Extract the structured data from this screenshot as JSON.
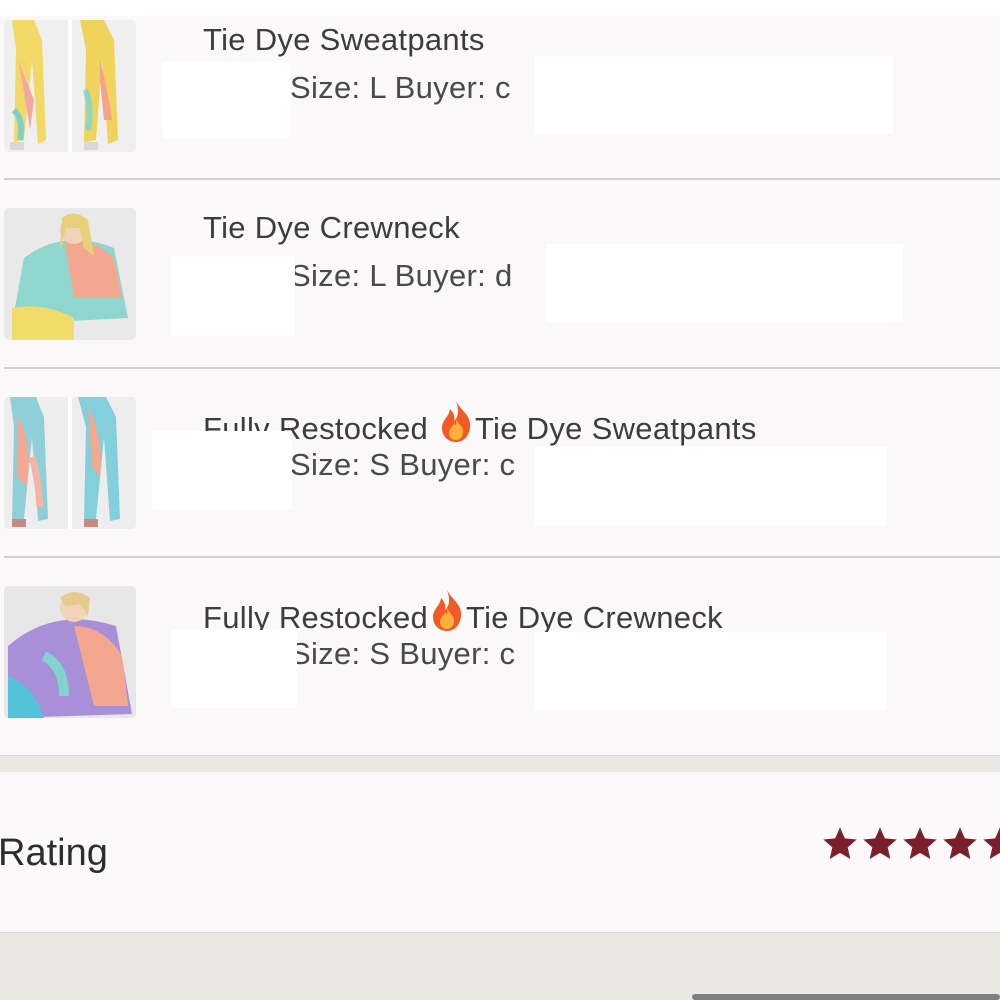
{
  "orders": [
    {
      "title": "Tie Dye Sweatpants",
      "meta": "Size: L  Buyer: c",
      "thumb_icon": "sweatpants-photo"
    },
    {
      "title": "Tie Dye Crewneck",
      "meta": "Size: L  Buyer: d",
      "thumb_icon": "crewneck-photo"
    },
    {
      "title_prefix": "Fullv Restocked ",
      "title_suffix": "Tie Dye Sweatpants",
      "meta": "Size: S  Buyer: c",
      "thumb_icon": "sweatpants-photo",
      "emoji": "fire-icon"
    },
    {
      "title_prefix": "Fully Restocked",
      "title_suffix": "Tie Dye Crewneck",
      "meta": "Size: S  Buyer: c",
      "thumb_icon": "crewneck-photo",
      "emoji": "fire-icon"
    }
  ],
  "rating": {
    "label": "Rating",
    "stars": 5,
    "star_color": "#7a1f2b"
  },
  "colors": {
    "background": "#faf8f8",
    "divider": "#cfcfcf",
    "band": "#eae8e3",
    "text": "#3d3d3d"
  }
}
